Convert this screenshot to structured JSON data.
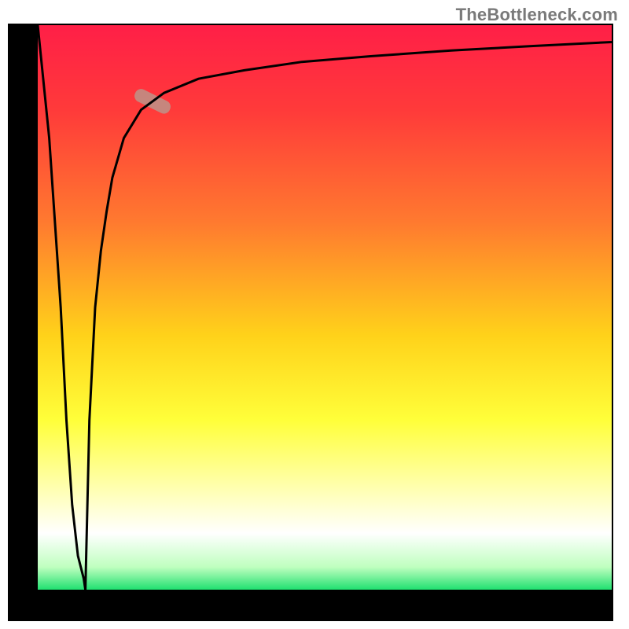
{
  "watermark": "TheBottleneck.com",
  "chart_data": {
    "type": "line",
    "title": "",
    "xlabel": "",
    "ylabel": "",
    "xlim": [
      0,
      100
    ],
    "ylim": [
      0,
      100
    ],
    "grid": false,
    "legend": false,
    "annotations": [
      {
        "kind": "highlight-segment",
        "x_range": [
          17,
          23
        ],
        "y_range": [
          85,
          88
        ],
        "color": "#c38a81"
      }
    ],
    "background_gradient": {
      "direction": "vertical",
      "stops": [
        {
          "offset": 0.0,
          "color": "#ff1f47"
        },
        {
          "offset": 0.15,
          "color": "#ff3a3a"
        },
        {
          "offset": 0.35,
          "color": "#ff7a2f"
        },
        {
          "offset": 0.55,
          "color": "#ffd21a"
        },
        {
          "offset": 0.7,
          "color": "#ffff3a"
        },
        {
          "offset": 0.82,
          "color": "#ffffb0"
        },
        {
          "offset": 0.9,
          "color": "#ffffff"
        },
        {
          "offset": 0.96,
          "color": "#bfffbf"
        },
        {
          "offset": 1.0,
          "color": "#20e070"
        }
      ]
    },
    "series": [
      {
        "name": "down-spike",
        "x": [
          0,
          2,
          4,
          5,
          6,
          7,
          8,
          8.3
        ],
        "y": [
          100,
          80,
          50,
          30,
          15,
          6,
          2,
          0
        ],
        "color": "#000000"
      },
      {
        "name": "log-asymptote",
        "x": [
          8.3,
          9,
          10,
          11,
          12,
          13,
          15,
          18,
          22,
          28,
          36,
          46,
          58,
          72,
          86,
          100
        ],
        "y": [
          0,
          30,
          50,
          60,
          67,
          73,
          80,
          85,
          88,
          90.5,
          92,
          93.5,
          94.5,
          95.5,
          96.3,
          97
        ],
        "color": "#000000"
      }
    ]
  }
}
